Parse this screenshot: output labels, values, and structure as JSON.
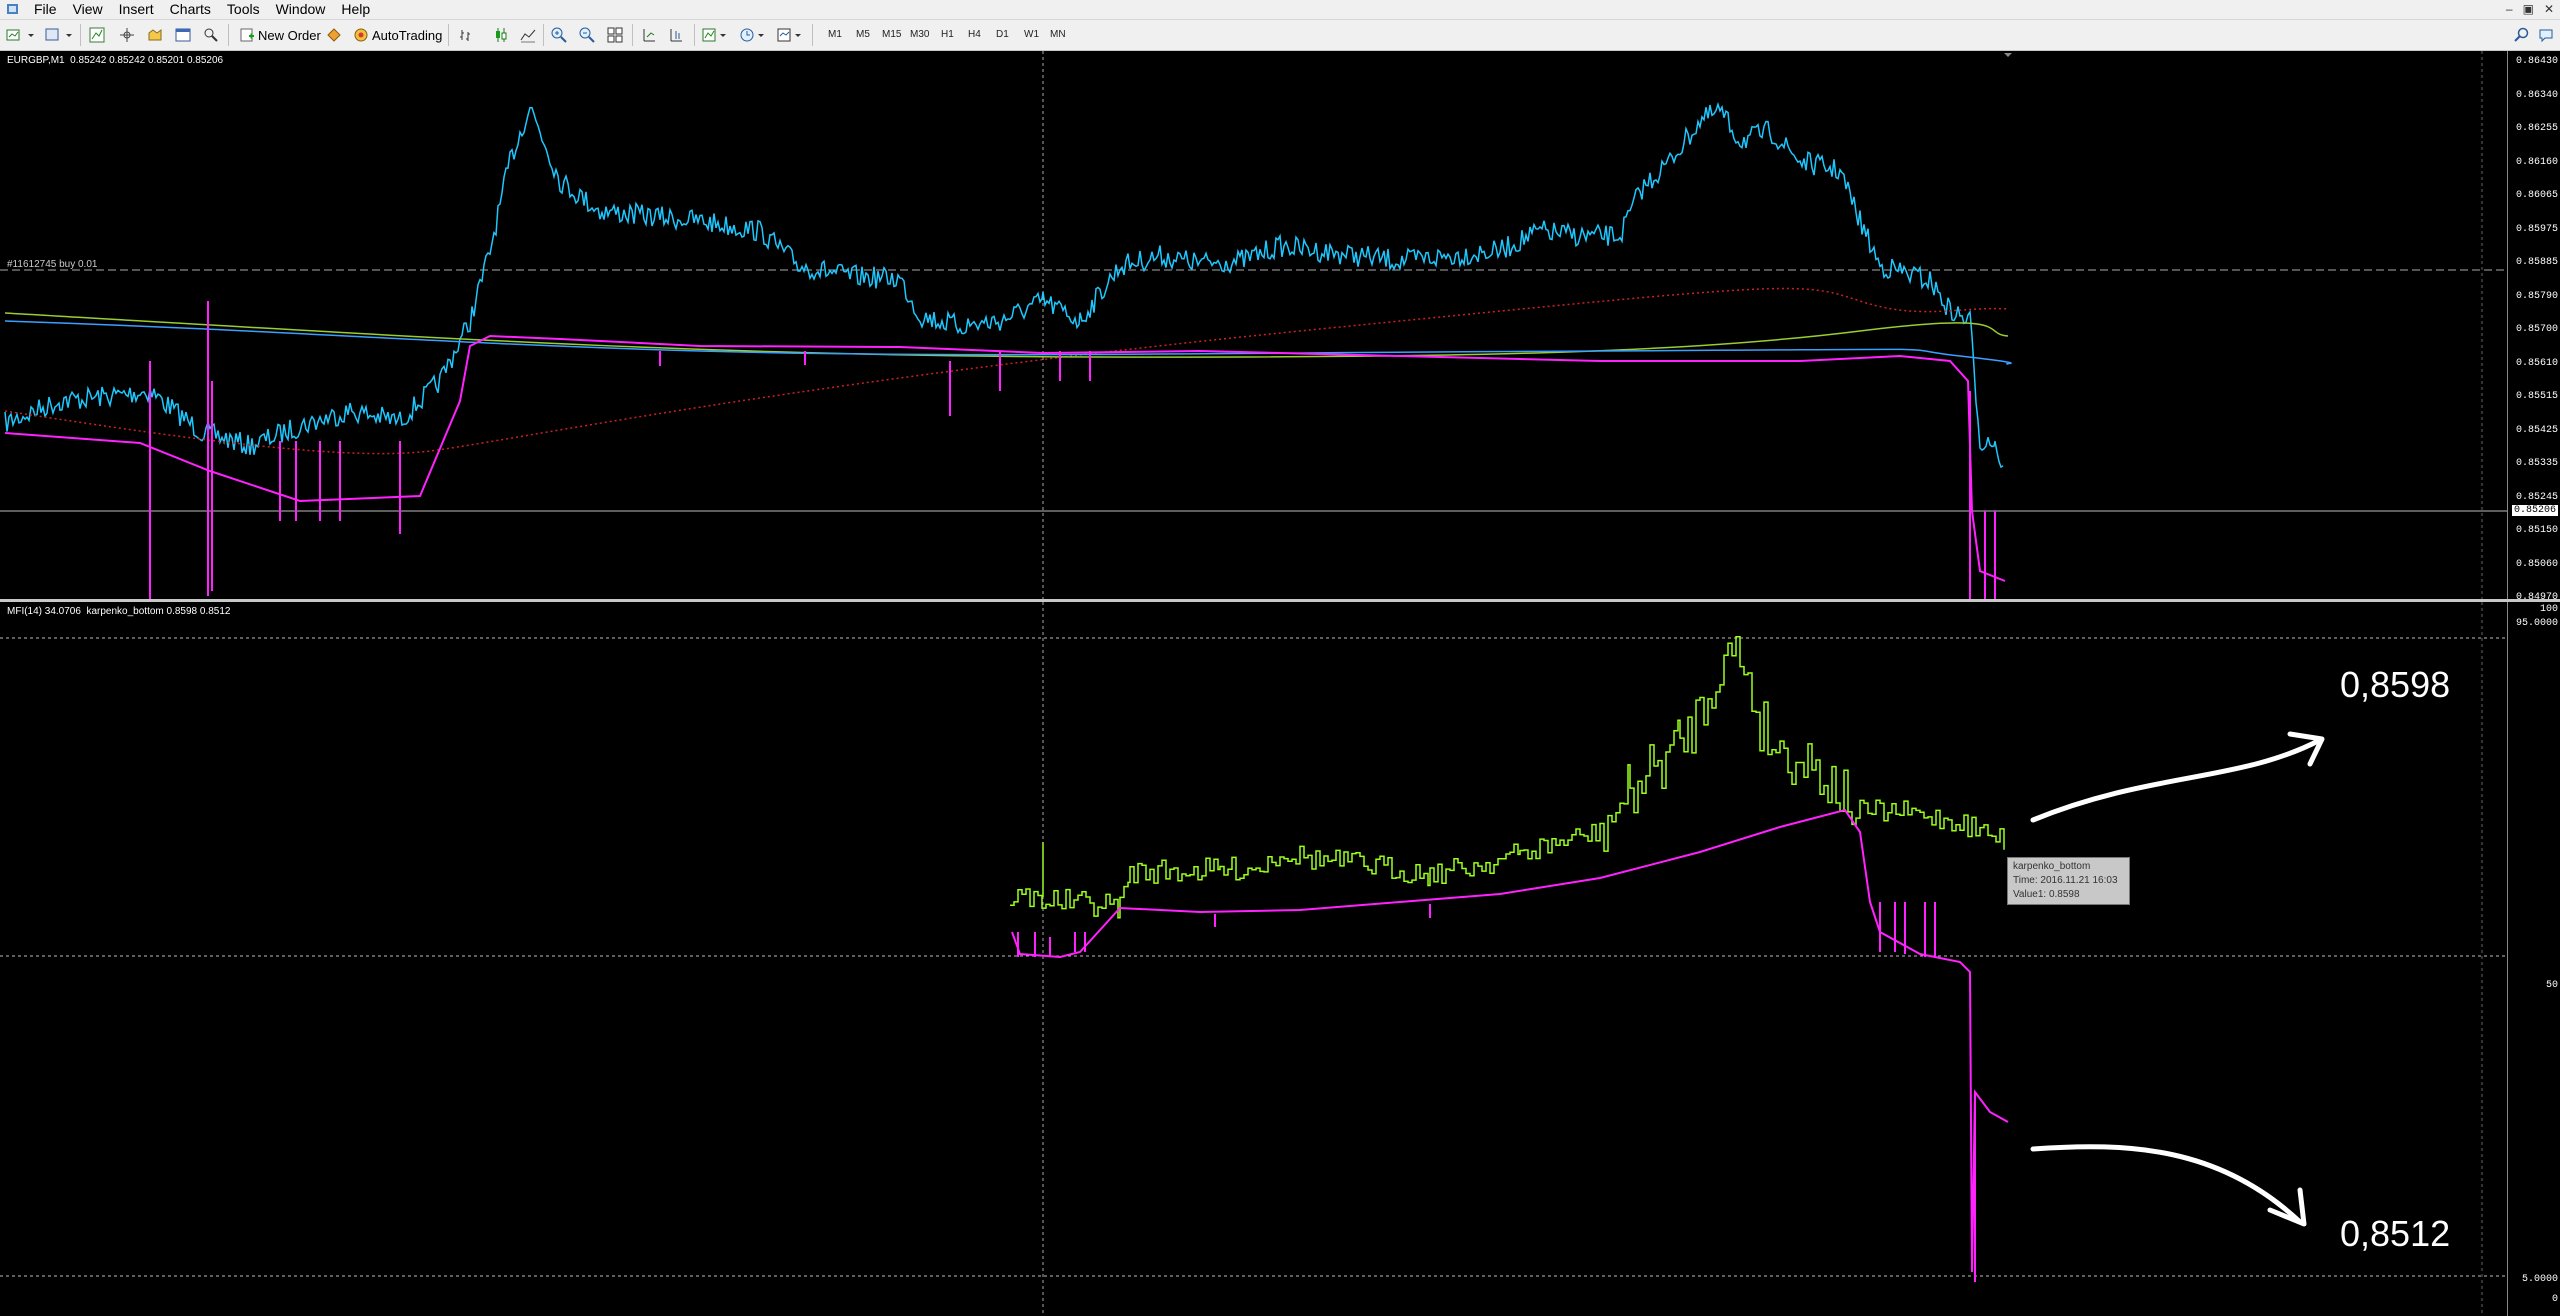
{
  "menu": {
    "items": [
      "File",
      "View",
      "Insert",
      "Charts",
      "Tools",
      "Window",
      "Help"
    ]
  },
  "toolbar": {
    "new_order_label": "New Order",
    "autotrading_label": "AutoTrading",
    "timeframes": [
      "M1",
      "M5",
      "M15",
      "M30",
      "H1",
      "H4",
      "D1",
      "W1",
      "MN"
    ]
  },
  "main_chart": {
    "title": "EURGBP,M1  0.85242 0.85242 0.85201 0.85206",
    "order_label": "#11612745 buy 0.01",
    "price_ticks": [
      "0.86430",
      "0.86340",
      "0.86255",
      "0.86160",
      "0.86065",
      "0.85975",
      "0.85885",
      "0.85790",
      "0.85700",
      "0.85610",
      "0.85515",
      "0.85425",
      "0.85335",
      "0.85245",
      "0.85150",
      "0.85060",
      "0.84970"
    ],
    "current_price": "0.85206",
    "colors": {
      "price": "#1ec8ff",
      "karpenko": "#ff22ff",
      "ma_green": "#9acd32",
      "ma_red": "#cc2222",
      "ma_blue": "#3aa0ff"
    }
  },
  "sub_chart": {
    "title": "MFI(14) 34.0706  karpenko_bottom 0.8598 0.8512",
    "ticks": [
      "100",
      "95.0000",
      "50",
      "5.0000",
      "0"
    ],
    "colors": {
      "mfi": "#9aff1a",
      "karpenko": "#ff22ff"
    }
  },
  "tooltip": {
    "name": "karpenko_bottom",
    "time": "Time: 2016.11.21 16:03",
    "value": "Value1: 0.8598"
  },
  "annotations": {
    "top_value": "0,8598",
    "bottom_value": "0,8512"
  }
}
